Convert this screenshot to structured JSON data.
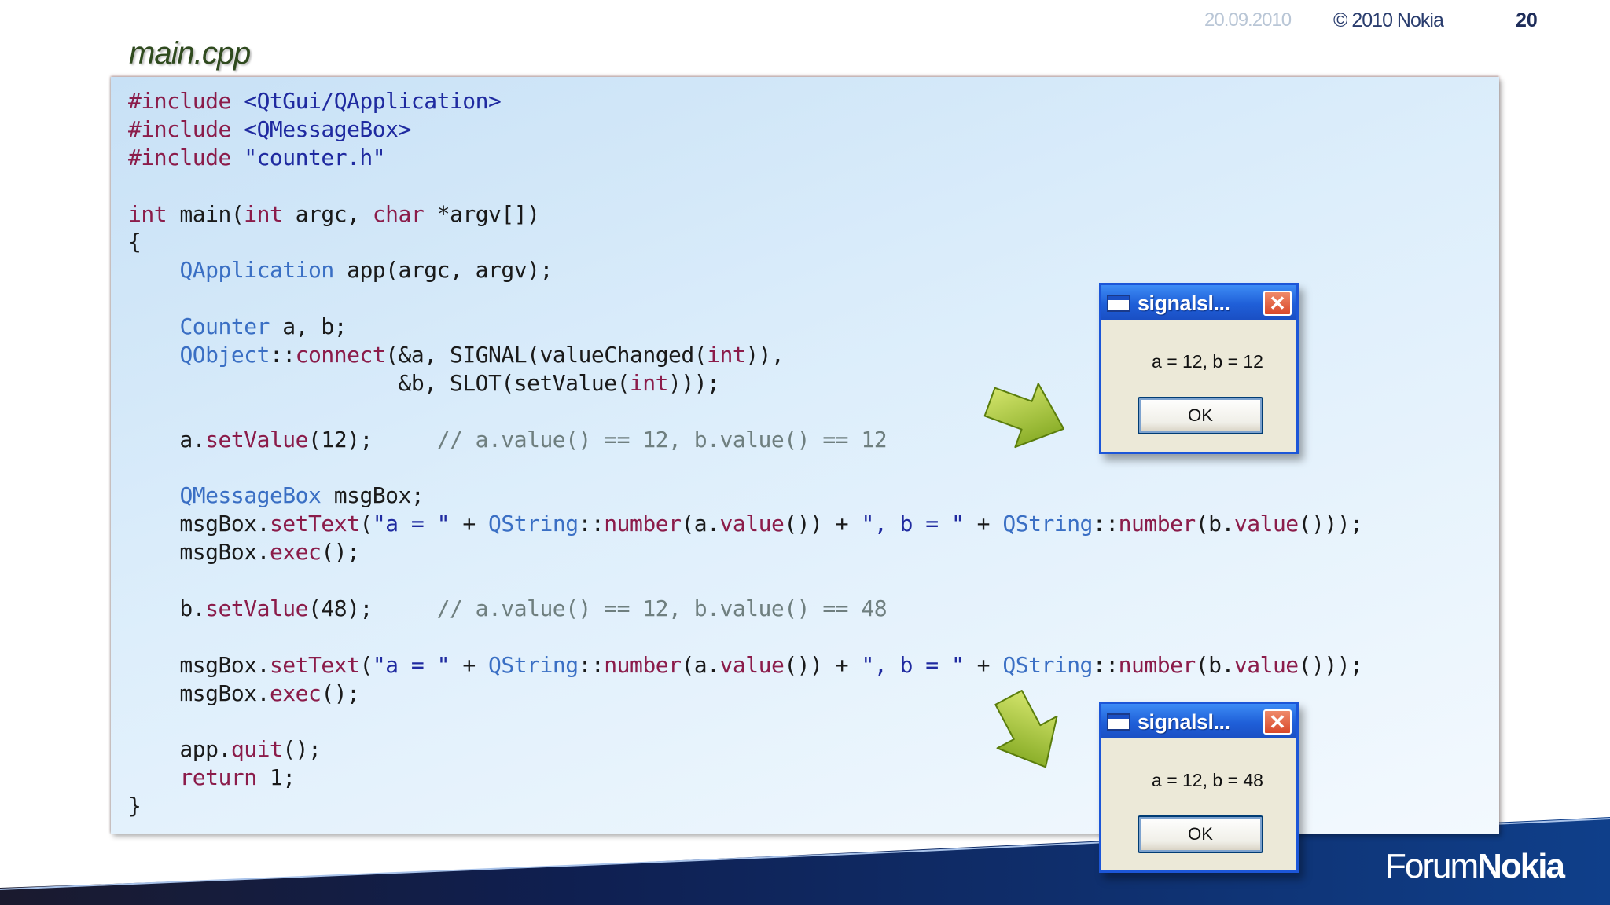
{
  "header": {
    "date": "20.09.2010",
    "copyright": "© 2010 Nokia",
    "page_number": "20"
  },
  "file_title": "main.cpp",
  "code_lines": [
    [
      [
        "k",
        "#include "
      ],
      [
        "s",
        "<QtGui/QApplication>"
      ]
    ],
    [
      [
        "k",
        "#include "
      ],
      [
        "s",
        "<QMessageBox>"
      ]
    ],
    [
      [
        "k",
        "#include "
      ],
      [
        "s",
        "\"counter.h\""
      ]
    ],
    [],
    [
      [
        "k",
        "int"
      ],
      [
        "p",
        " main("
      ],
      [
        "k",
        "int"
      ],
      [
        "p",
        " argc, "
      ],
      [
        "k",
        "char"
      ],
      [
        "p",
        " *argv[])"
      ]
    ],
    [
      [
        "p",
        "{"
      ]
    ],
    [
      [
        "p",
        "    "
      ],
      [
        "t",
        "QApplication"
      ],
      [
        "p",
        " app(argc, argv);"
      ]
    ],
    [],
    [
      [
        "p",
        "    "
      ],
      [
        "t",
        "Counter"
      ],
      [
        "p",
        " a, b;"
      ]
    ],
    [
      [
        "p",
        "    "
      ],
      [
        "t",
        "QObject"
      ],
      [
        "p",
        "::"
      ],
      [
        "f",
        "connect"
      ],
      [
        "p",
        "(&a, SIGNAL(valueChanged("
      ],
      [
        "k",
        "int"
      ],
      [
        "p",
        ")),"
      ]
    ],
    [
      [
        "p",
        "                     &b, SLOT(setValue("
      ],
      [
        "k",
        "int"
      ],
      [
        "p",
        ")));"
      ]
    ],
    [],
    [
      [
        "p",
        "    a."
      ],
      [
        "f",
        "setValue"
      ],
      [
        "p",
        "(12);     "
      ],
      [
        "c",
        "// a.value() == 12, b.value() == 12"
      ]
    ],
    [],
    [
      [
        "p",
        "    "
      ],
      [
        "t",
        "QMessageBox"
      ],
      [
        "p",
        " msgBox;"
      ]
    ],
    [
      [
        "p",
        "    msgBox."
      ],
      [
        "f",
        "setText"
      ],
      [
        "p",
        "("
      ],
      [
        "s",
        "\"a = \""
      ],
      [
        "p",
        " + "
      ],
      [
        "t",
        "QString"
      ],
      [
        "p",
        "::"
      ],
      [
        "f",
        "number"
      ],
      [
        "p",
        "(a."
      ],
      [
        "f",
        "value"
      ],
      [
        "p",
        "()) + "
      ],
      [
        "s",
        "\", b = \""
      ],
      [
        "p",
        " + "
      ],
      [
        "t",
        "QString"
      ],
      [
        "p",
        "::"
      ],
      [
        "f",
        "number"
      ],
      [
        "p",
        "(b."
      ],
      [
        "f",
        "value"
      ],
      [
        "p",
        "()));"
      ]
    ],
    [
      [
        "p",
        "    msgBox."
      ],
      [
        "f",
        "exec"
      ],
      [
        "p",
        "();"
      ]
    ],
    [],
    [
      [
        "p",
        "    b."
      ],
      [
        "f",
        "setValue"
      ],
      [
        "p",
        "(48);     "
      ],
      [
        "c",
        "// a.value() == 12, b.value() == 48"
      ]
    ],
    [],
    [
      [
        "p",
        "    msgBox."
      ],
      [
        "f",
        "setText"
      ],
      [
        "p",
        "("
      ],
      [
        "s",
        "\"a = \""
      ],
      [
        "p",
        " + "
      ],
      [
        "t",
        "QString"
      ],
      [
        "p",
        "::"
      ],
      [
        "f",
        "number"
      ],
      [
        "p",
        "(a."
      ],
      [
        "f",
        "value"
      ],
      [
        "p",
        "()) + "
      ],
      [
        "s",
        "\", b = \""
      ],
      [
        "p",
        " + "
      ],
      [
        "t",
        "QString"
      ],
      [
        "p",
        "::"
      ],
      [
        "f",
        "number"
      ],
      [
        "p",
        "(b."
      ],
      [
        "f",
        "value"
      ],
      [
        "p",
        "()));"
      ]
    ],
    [
      [
        "p",
        "    msgBox."
      ],
      [
        "f",
        "exec"
      ],
      [
        "p",
        "();"
      ]
    ],
    [],
    [
      [
        "p",
        "    app."
      ],
      [
        "f",
        "quit"
      ],
      [
        "p",
        "();"
      ]
    ],
    [
      [
        "p",
        "    "
      ],
      [
        "k",
        "return"
      ],
      [
        "p",
        " 1;"
      ]
    ],
    [
      [
        "p",
        "}"
      ]
    ]
  ],
  "dialogs": [
    {
      "title": "signalsl...",
      "message": "a = 12, b = 12",
      "ok_label": "OK",
      "close_glyph": "✕"
    },
    {
      "title": "signalsl...",
      "message": "a = 12, b = 48",
      "ok_label": "OK",
      "close_glyph": "✕"
    }
  ],
  "icons": {
    "arrow_color": "#a6c81e",
    "window_icon": "window-icon",
    "close_icon": "close-icon"
  },
  "footer": {
    "brand_light": "Forum",
    "brand_bold": "Nokia"
  }
}
